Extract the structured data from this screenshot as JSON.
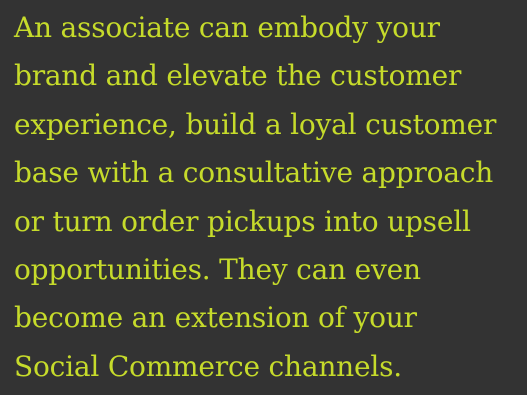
{
  "body_text": {
    "lines": [
      "An associate can embody your",
      "brand and elevate the customer",
      "experience, build a loyal customer",
      "base with a consultative approach",
      "or turn order pickups into upsell",
      "opportunities. They can even",
      "become an extension of your",
      "Social Commerce channels."
    ]
  },
  "colors": {
    "background": "#333333",
    "text": "#c6db2b"
  }
}
